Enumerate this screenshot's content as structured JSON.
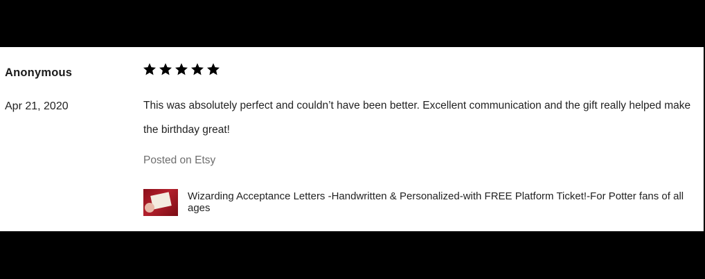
{
  "review": {
    "reviewer": "Anonymous",
    "date": "Apr 21, 2020",
    "rating": 5,
    "rating_max": 5,
    "star_color": "#000000",
    "text": "This was absolutely perfect and couldn’t have been better. Excellent communication and the gift really helped make the birthday great!",
    "source": "Posted on Etsy",
    "listing": {
      "title": "Wizarding Acceptance Letters -Handwritten & Personalized-with FREE Platform Ticket!-For Potter fans of all ages",
      "thumbnail_icon": "letter-photo-thumbnail"
    }
  }
}
